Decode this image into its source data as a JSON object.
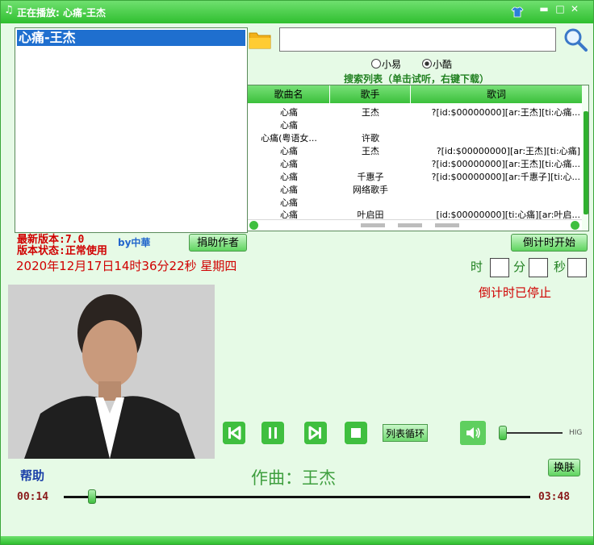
{
  "window": {
    "title": "正在播放: 心痛-王杰",
    "accent": "#2fbf2f"
  },
  "playlist": {
    "items": [
      "心痛-王杰"
    ],
    "selected_index": 0
  },
  "search": {
    "value": "",
    "placeholder": ""
  },
  "sources": {
    "options": [
      "小易",
      "小酷"
    ],
    "selected": "小酷",
    "hint": "搜索列表（单击试听，右键下载）"
  },
  "results": {
    "columns": [
      "歌曲名",
      "歌手",
      "歌词"
    ],
    "rows": [
      {
        "song": "心痛",
        "artist": "王杰",
        "lyric": "?[id:$00000000][ar:王杰][ti:心痛..."
      },
      {
        "song": "心痛",
        "artist": "",
        "lyric": ""
      },
      {
        "song": "心痛(粤语女...",
        "artist": "许歌",
        "lyric": ""
      },
      {
        "song": "心痛",
        "artist": "王杰",
        "lyric": "?[id:$00000000][ar:王杰][ti:心痛]"
      },
      {
        "song": "心痛",
        "artist": "",
        "lyric": "?[id:$00000000][ar:王杰][ti:心痛..."
      },
      {
        "song": "心痛",
        "artist": "千惠子",
        "lyric": "?[id:$00000000][ar:千惠子][ti:心..."
      },
      {
        "song": "心痛",
        "artist": "网络歌手",
        "lyric": ""
      },
      {
        "song": "心痛",
        "artist": "",
        "lyric": ""
      },
      {
        "song": "心痛",
        "artist": "叶启田",
        "lyric": "[id:$00000000][ti:心痛][ar:叶启..."
      }
    ]
  },
  "info": {
    "version": "最新版本:7.0",
    "status": "版本状态:正常使用",
    "author": "by中華",
    "donate_label": "捐助作者",
    "datetime": "2020年12月17日14时36分22秒  星期四"
  },
  "timer": {
    "start_label": "倒计时开始",
    "hour_label": "时",
    "minute_label": "分",
    "second_label": "秒",
    "status": "倒计时已停止"
  },
  "player": {
    "loop_label": "列表循环",
    "volume_label": "HIG",
    "volume_level": 0.05,
    "help_label": "帮助",
    "composer": "作曲：王杰",
    "skin_label": "换肤",
    "current_time": "00:14",
    "total_time": "03:48",
    "progress": 0.0614
  }
}
